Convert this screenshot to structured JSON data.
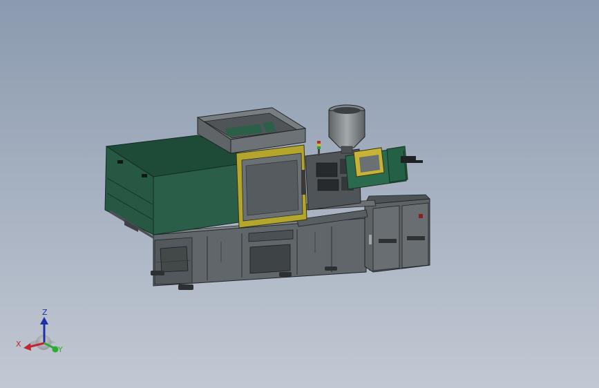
{
  "viewport": {
    "background_top": "#8b9aaf",
    "background_bottom": "#c2c8d3"
  },
  "model": {
    "body_color": "#225440",
    "frame_color": "#555b5e",
    "trim_color": "#b4a62c"
  },
  "triad": {
    "x_label": "X",
    "y_label": "Y",
    "z_label": "Z",
    "x_color": "#c0262b",
    "y_color": "#2eaa36",
    "z_color": "#1c2fa8"
  }
}
